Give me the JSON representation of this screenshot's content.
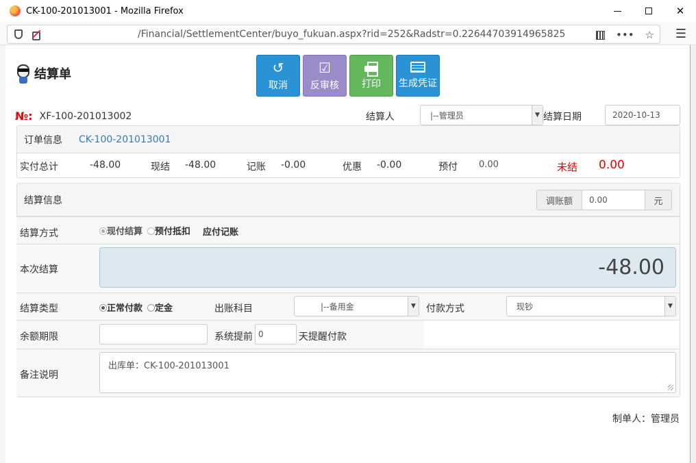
{
  "window": {
    "title": "CK-100-201013001 - Mozilla Firefox",
    "url": "/Financial/SettlementCenter/buyo_fukuan.aspx?rid=252&Radstr=0.22644703914965825"
  },
  "header": {
    "title": "结算单",
    "buttons": {
      "cancel": "取消",
      "unapprove": "反审核",
      "print": "打印",
      "voucher": "生成凭证"
    }
  },
  "doc": {
    "no_label": "№:",
    "no_value": "XF-100-201013002",
    "settler_label": "结算人",
    "settler_value": "|--管理员",
    "date_label": "结算日期",
    "date_value": "2020-10-13"
  },
  "order": {
    "label": "订单信息",
    "link": "CK-100-201013001",
    "totals": {
      "actual_label": "实付总计",
      "actual_value": "-48.00",
      "cash_label": "现结",
      "cash_value": "-48.00",
      "credit_label": "记账",
      "credit_value": "-0.00",
      "discount_label": "优惠",
      "discount_value": "-0.00",
      "prepaid_label": "预付",
      "prepaid_value": "0.00",
      "unsettled_label": "未结",
      "unsettled_value": "0.00"
    }
  },
  "settlement": {
    "label": "结算信息",
    "adjust_label": "调账额",
    "adjust_value": "0.00",
    "adjust_unit": "元",
    "method_label": "结算方式",
    "method_options": [
      "现付结算",
      "预付抵扣",
      "应付记账"
    ],
    "current_label": "本次结算",
    "current_value": "-48.00",
    "type_label": "结算类型",
    "type_options": [
      "正常付款",
      "定金"
    ],
    "account_label": "出账科目",
    "account_value": "|--备用金",
    "payment_label": "付款方式",
    "payment_value": "现钞",
    "limit_label": "余额期限",
    "limit_value": "",
    "remind_prefix": "系统提前",
    "remind_value": "0",
    "remind_suffix": "天提醒付款",
    "remark_label": "备注说明",
    "remark_value": "出库单：CK-100-201013001"
  },
  "footer": {
    "maker": "制单人：管理员"
  }
}
